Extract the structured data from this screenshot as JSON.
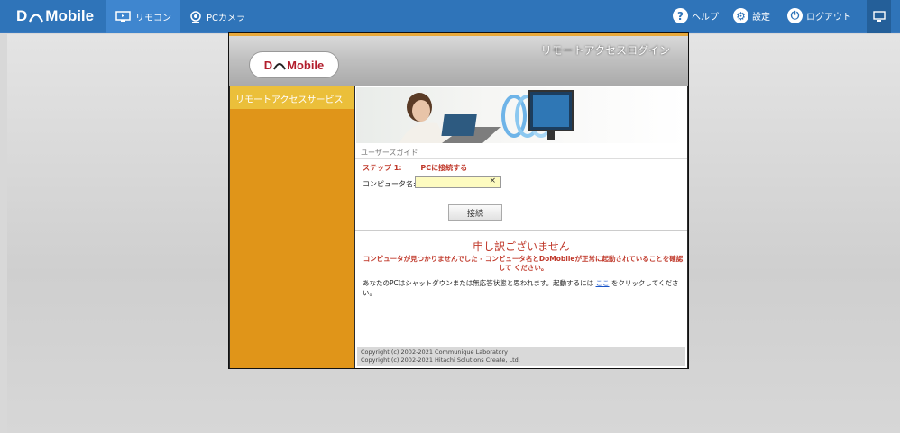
{
  "topbar": {
    "logo_left": "D",
    "logo_right": "Mobile",
    "tabs": [
      {
        "label": "リモコン",
        "active": true
      },
      {
        "label": "PCカメラ",
        "active": false
      }
    ],
    "right": [
      {
        "icon": "?",
        "label": "ヘルプ"
      },
      {
        "icon": "⚙",
        "label": "設定"
      },
      {
        "icon": "⏻",
        "label": "ログアウト"
      }
    ]
  },
  "window": {
    "title": "リモートアクセスログイン",
    "logo_left": "D",
    "logo_right": "Mobile",
    "sidebar_title": "リモートアクセスサービス",
    "guide": "ユーザーズガイド",
    "step_label": "ステップ 1:",
    "step_text": "PCに接続する",
    "computer_label": "コンピュータ名:",
    "computer_value": "",
    "clear": "×",
    "connect": "接続",
    "sorry": "申し訳ございません",
    "error": "コンピュータが見つかりませんでした - コンピュータ名とDoMobileが正常に起動されていることを確認して ください。",
    "info_before": "あなたのPCはシャットダウンまたは無応答状態と思われます。起動するには",
    "info_link": "ここ",
    "info_after": "をクリックしてください。",
    "copyright1": "Copyright (c) 2002-2021 Communique Laboratory",
    "copyright2": "Copyright (c) 2002-2021 Hitachi Solutions Create, Ltd."
  },
  "colors": {
    "topbar": "#2f74b9",
    "sidebar": "#e09519",
    "error": "#c0392b",
    "input": "#fdfbc0"
  }
}
